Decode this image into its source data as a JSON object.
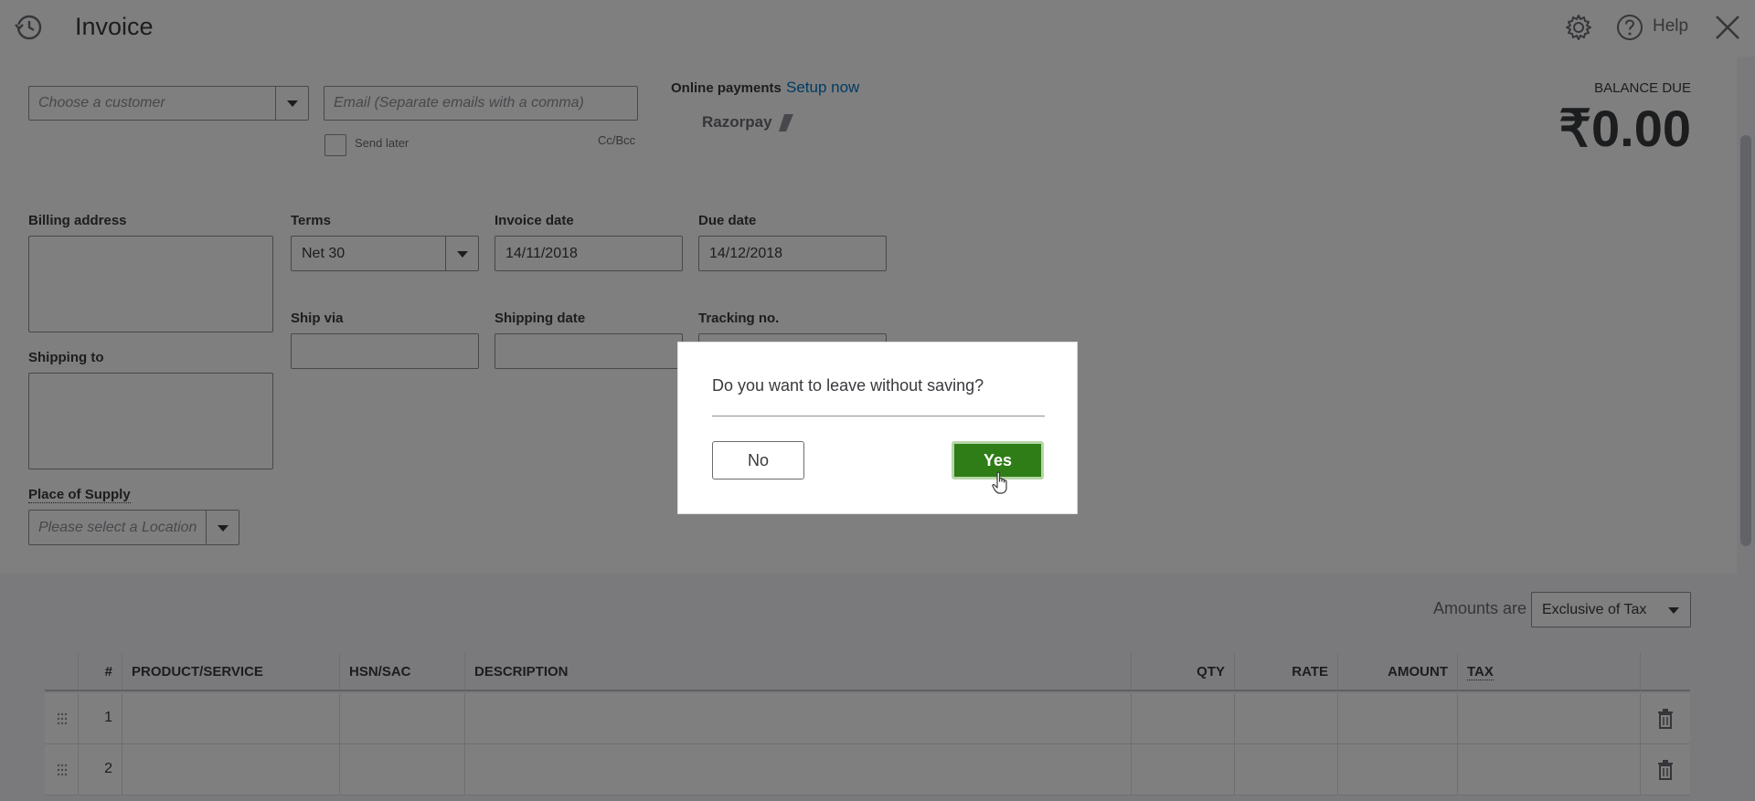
{
  "header": {
    "title": "Invoice",
    "help_label": "Help"
  },
  "customer": {
    "placeholder": "Choose a customer"
  },
  "email": {
    "placeholder": "Email (Separate emails with a comma)",
    "send_later_label": "Send later",
    "cc_bcc_label": "Cc/Bcc"
  },
  "online_payments": {
    "label": "Online payments",
    "setup_link": "Setup now",
    "provider": "Razorpay"
  },
  "balance": {
    "label": "BALANCE DUE",
    "value": "₹0.00"
  },
  "billing_address": {
    "label": "Billing address"
  },
  "shipping_to": {
    "label": "Shipping to"
  },
  "terms": {
    "label": "Terms",
    "value": "Net 30"
  },
  "invoice_date": {
    "label": "Invoice date",
    "value": "14/11/2018"
  },
  "due_date": {
    "label": "Due date",
    "value": "14/12/2018"
  },
  "ship_via": {
    "label": "Ship via"
  },
  "shipping_date": {
    "label": "Shipping date"
  },
  "tracking": {
    "label": "Tracking no."
  },
  "place_of_supply": {
    "label": "Place of Supply",
    "placeholder": "Please select a Location"
  },
  "amounts": {
    "label": "Amounts are",
    "value": "Exclusive of Tax"
  },
  "table": {
    "columns": [
      "#",
      "PRODUCT/SERVICE",
      "HSN/SAC",
      "DESCRIPTION",
      "QTY",
      "RATE",
      "AMOUNT",
      "TAX"
    ],
    "rows": [
      {
        "num": "1"
      },
      {
        "num": "2"
      }
    ]
  },
  "dialog": {
    "message": "Do you want to leave without saving?",
    "no_label": "No",
    "yes_label": "Yes"
  },
  "colors": {
    "primary_green": "#2e7d17",
    "link_blue": "#0077c5",
    "text": "#393a3d"
  },
  "icons": [
    "history-icon",
    "gear-icon",
    "help-icon",
    "close-icon",
    "chevron-down-icon",
    "drag-handle-icon",
    "trash-icon",
    "razorpay-logo-icon",
    "pointer-cursor-icon"
  ]
}
